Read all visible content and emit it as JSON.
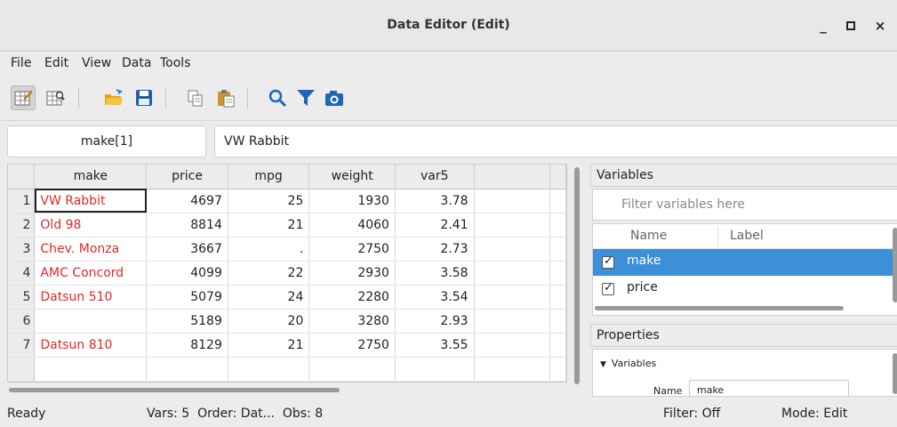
{
  "window": {
    "title": "Data Editor (Edit)",
    "minimize": "_",
    "maximize": "▫",
    "close": "×"
  },
  "menu": [
    "File",
    "Edit",
    "View",
    "Data",
    "Tools"
  ],
  "toolbar": {
    "icons": [
      "edit-mode-icon",
      "browse-mode-icon",
      "open-folder-icon",
      "save-icon",
      "copy-icon",
      "paste-icon",
      "search-icon",
      "filter-icon",
      "snapshot-icon"
    ],
    "active": "edit-mode-icon"
  },
  "cellbar": {
    "ref": "make[1]",
    "value": "VW Rabbit"
  },
  "grid": {
    "columns": [
      "make",
      "price",
      "mpg",
      "weight",
      "var5"
    ],
    "rows": [
      {
        "n": "1",
        "make": "VW Rabbit",
        "price": "4697",
        "mpg": "25",
        "weight": "1930",
        "var5": "3.78"
      },
      {
        "n": "2",
        "make": "Old 98",
        "price": "8814",
        "mpg": "21",
        "weight": "4060",
        "var5": "2.41"
      },
      {
        "n": "3",
        "make": "Chev. Monza",
        "price": "3667",
        "mpg": ".",
        "weight": "2750",
        "var5": "2.73"
      },
      {
        "n": "4",
        "make": "AMC Concord",
        "price": "4099",
        "mpg": "22",
        "weight": "2930",
        "var5": "3.58"
      },
      {
        "n": "5",
        "make": "Datsun 510",
        "price": "5079",
        "mpg": "24",
        "weight": "2280",
        "var5": "3.54"
      },
      {
        "n": "6",
        "make": "",
        "price": "5189",
        "mpg": "20",
        "weight": "3280",
        "var5": "2.93"
      },
      {
        "n": "7",
        "make": "Datsun 810",
        "price": "8129",
        "mpg": "21",
        "weight": "2750",
        "var5": "3.55"
      }
    ],
    "string_color": "#e4282a"
  },
  "variables": {
    "title": "Variables",
    "filter_placeholder": "Filter variables here",
    "col_name": "Name",
    "col_label": "Label",
    "items": [
      {
        "name": "make",
        "checked": true,
        "selected": true
      },
      {
        "name": "price",
        "checked": true,
        "selected": false
      }
    ],
    "selection_color": "#3d8fd8"
  },
  "properties": {
    "title": "Properties",
    "section": "Variables",
    "name_label": "Name",
    "name_value": "make"
  },
  "status": {
    "ready": "Ready",
    "info": "Vars: 5  Order: Dat...  Obs: 8",
    "filter": "Filter: Off",
    "mode": "Mode: Edit"
  }
}
